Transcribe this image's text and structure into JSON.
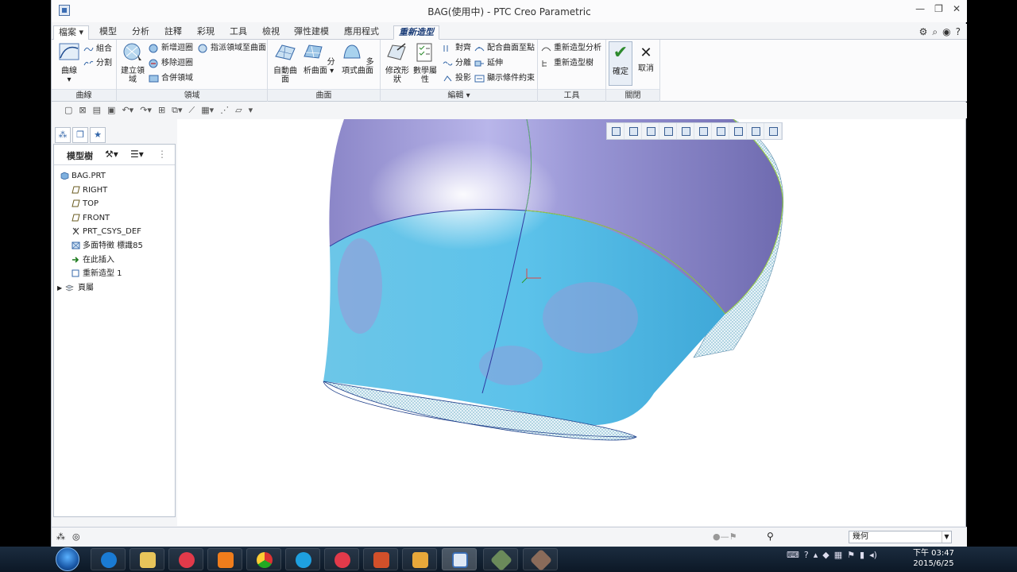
{
  "window": {
    "title": "BAG(使用中) - PTC Creo Parametric",
    "controls": [
      "minimize-icon",
      "restore-icon",
      "close-icon"
    ]
  },
  "menubar": {
    "file": "檔案",
    "tabs": [
      "模型",
      "分析",
      "註釋",
      "彩現",
      "工具",
      "檢視",
      "彈性建模",
      "應用程式",
      "重新造型"
    ]
  },
  "ribbon": {
    "groups": {
      "curve": "曲線",
      "region": "領域",
      "surface": "曲面",
      "edit": "編輯",
      "tools": "工具",
      "close": "關閉"
    },
    "curve": {
      "big": "曲線",
      "combine": "組合",
      "split": "分割"
    },
    "region": {
      "big1": "建立領",
      "big2": "域",
      "add_loop": "新增迴圈",
      "remove_loop": "移除迴圈",
      "merge_region": "合併領域",
      "assign_region": "指派領域至曲面"
    },
    "surface": {
      "auto1": "自動曲",
      "auto2": "面",
      "analytic": "分析曲面",
      "polynomial": "多項式曲面"
    },
    "edit": {
      "modify1": "修改形",
      "modify2": "狀",
      "math1": "數學屬",
      "math2": "性",
      "align": "對齊",
      "split": "分離",
      "project": "投影",
      "fit_to_surface": "配合曲面至點",
      "extend": "延伸",
      "show_constraints": "顯示條件約束"
    },
    "tools": {
      "reshape_analysis": "重新造型分析",
      "reshape_tree": "重新造型樹"
    },
    "close": {
      "ok": "確定",
      "cancel": "取消"
    }
  },
  "model_tree": {
    "title": "模型樹",
    "nodes": [
      {
        "label": "BAG.PRT",
        "icon": "part-icon"
      },
      {
        "label": "RIGHT",
        "icon": "datum-plane-icon"
      },
      {
        "label": "TOP",
        "icon": "datum-plane-icon"
      },
      {
        "label": "FRONT",
        "icon": "datum-plane-icon"
      },
      {
        "label": "PRT_CSYS_DEF",
        "icon": "csys-icon"
      },
      {
        "label": "多面特徵 標識85",
        "icon": "facet-icon"
      },
      {
        "label": "在此插入",
        "icon": "insert-arrow-icon"
      },
      {
        "label": "重新造型 1",
        "icon": "reshape-icon"
      },
      {
        "label": "頁屬",
        "icon": "layer-icon"
      }
    ]
  },
  "statusbar": {
    "filter_value": "幾何"
  },
  "taskbar": {
    "time": "下午 03:47",
    "date": "2015/6/25"
  }
}
